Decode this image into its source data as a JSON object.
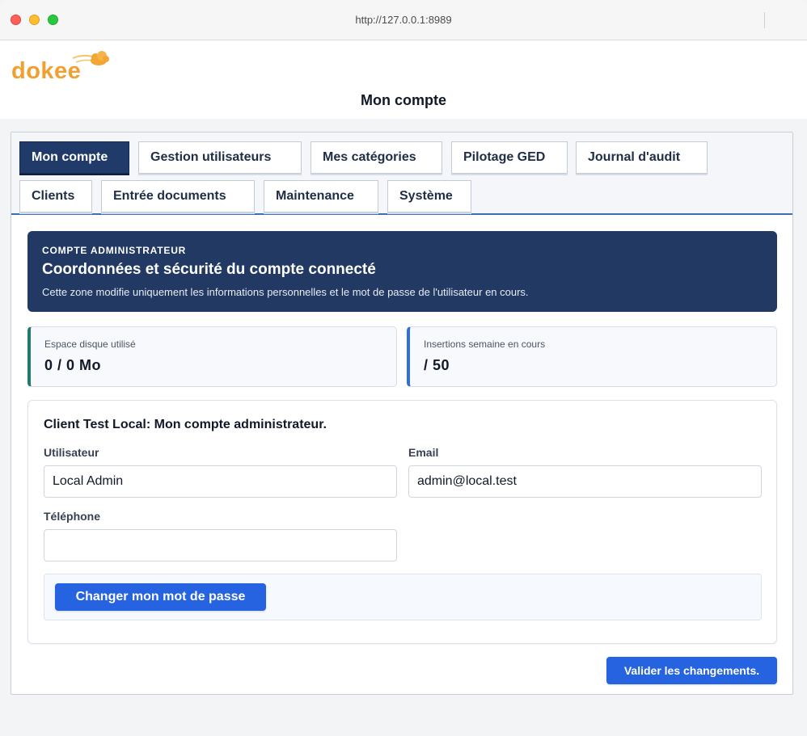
{
  "browser": {
    "url": "http://127.0.0.1:8989"
  },
  "header": {
    "logo_text": "dokee",
    "page_title": "Mon compte"
  },
  "tabs": [
    {
      "label": "Mon compte",
      "active": true
    },
    {
      "label": "Gestion utilisateurs",
      "active": false
    },
    {
      "label": "Mes catégories",
      "active": false
    },
    {
      "label": "Pilotage GED",
      "active": false
    },
    {
      "label": "Journal d'audit",
      "active": false
    },
    {
      "label": "Clients",
      "active": false
    },
    {
      "label": "Entrée documents",
      "active": false
    },
    {
      "label": "Maintenance",
      "active": false
    },
    {
      "label": "Système",
      "active": false
    }
  ],
  "banner": {
    "eyebrow": "COMPTE ADMINISTRATEUR",
    "title": "Coordonnées et sécurité du compte connecté",
    "description": "Cette zone modifie uniquement les informations personnelles et le mot de passe de l'utilisateur en cours."
  },
  "stats": [
    {
      "label": "Espace disque utilisé",
      "value": "0 / 0 Mo"
    },
    {
      "label": "Insertions semaine en cours",
      "value": "/ 50"
    }
  ],
  "form": {
    "heading": "Client Test Local: Mon compte administrateur.",
    "user_label": "Utilisateur",
    "user_value": "Local Admin",
    "email_label": "Email",
    "email_value": "admin@local.test",
    "phone_label": "Téléphone",
    "phone_value": "",
    "change_password_label": "Changer mon mot de passe"
  },
  "footer": {
    "validate_label": "Valider les changements."
  },
  "colors": {
    "navy_active_tab": "#203a6a",
    "banner_bg": "#223a63",
    "primary_button": "#2563e0",
    "stat_accent_teal": "#1f7a6d",
    "stat_accent_blue": "#2f6fdc",
    "logo_orange": "#f0a030"
  }
}
